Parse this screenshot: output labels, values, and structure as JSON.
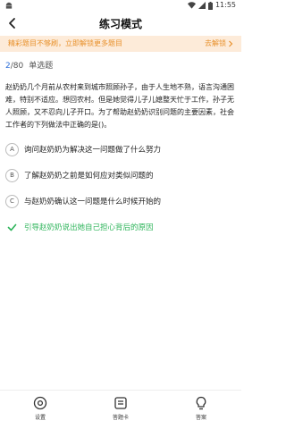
{
  "status": {
    "time": "11:55"
  },
  "header": {
    "title": "练习模式"
  },
  "banner": {
    "message": "精彩题目不够刷，立即解锁更多题目",
    "action": "去解锁"
  },
  "question": {
    "current": "2",
    "total": "/80",
    "type": "单选题",
    "text": "赵奶奶几个月前从农村来到城市照顾孙子，由于人生地不熟，语言沟通困难，特别不适应。想回农村。但是她觉得儿子儿媳整天忙于工作，孙子无人照顾，又不忍向儿子开口。为了帮助赵奶奶识别问题的主要因素，社会工作者的下列做法中正确的是()。"
  },
  "options": [
    {
      "letter": "A",
      "text": "询问赵奶奶为解决这一问题做了什么努力"
    },
    {
      "letter": "B",
      "text": "了解赵奶奶之前是如何应对类似问题的"
    },
    {
      "letter": "C",
      "text": "与赵奶奶确认这一问题是什么时候开始的"
    },
    {
      "letter": "D",
      "text": "引导赵奶奶说出她自己担心背后的原因"
    }
  ],
  "nav": {
    "settings": "设置",
    "answer_card": "答题卡",
    "answer": "答案"
  },
  "colors": {
    "accent": "#2E6FD8",
    "correct": "#2DB45A",
    "banner_text": "#E8912C",
    "banner_bg": "#FDEBD9"
  }
}
